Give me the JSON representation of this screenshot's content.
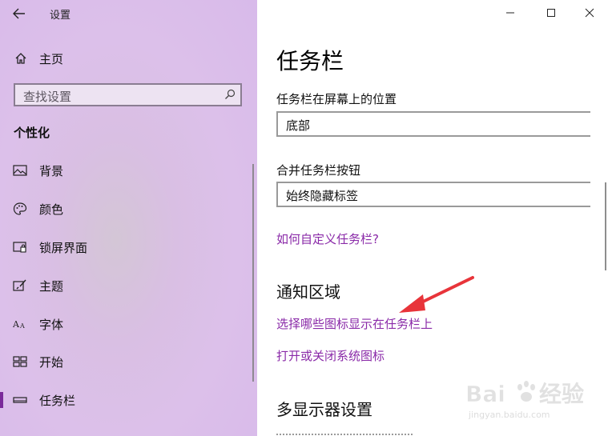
{
  "window": {
    "title": "设置",
    "controls": [
      "minimize-icon",
      "maximize-icon",
      "close-icon"
    ]
  },
  "nav": {
    "home": "主页",
    "search_placeholder": "查找设置",
    "section": "个性化",
    "items": [
      {
        "label": "背景",
        "icon": "picture-icon",
        "selected": false
      },
      {
        "label": "颜色",
        "icon": "palette-icon",
        "selected": false
      },
      {
        "label": "锁屏界面",
        "icon": "lockscreen-icon",
        "selected": false
      },
      {
        "label": "主题",
        "icon": "theme-brush-icon",
        "selected": false
      },
      {
        "label": "字体",
        "icon": "font-icon",
        "selected": false
      },
      {
        "label": "开始",
        "icon": "start-tiles-icon",
        "selected": false
      },
      {
        "label": "任务栏",
        "icon": "taskbar-icon",
        "selected": true
      }
    ]
  },
  "main": {
    "title": "任务栏",
    "position_label": "任务栏在屏幕上的位置",
    "position_value": "底部",
    "combine_label": "合并任务栏按钮",
    "combine_value": "始终隐藏标签",
    "help_link": "如何自定义任务栏?",
    "notify_heading": "通知区域",
    "notify_link_1": "选择哪些图标显示在任务栏上",
    "notify_link_2": "打开或关闭系统图标",
    "multi_heading": "多显示器设置"
  },
  "watermark": {
    "brand": "Baidu经验",
    "url": "jingyan.baidu.com"
  },
  "colors": {
    "accent": "#8a2aa8",
    "annotation_arrow": "#e8343a",
    "nav_bg": "#dcc0ea"
  }
}
